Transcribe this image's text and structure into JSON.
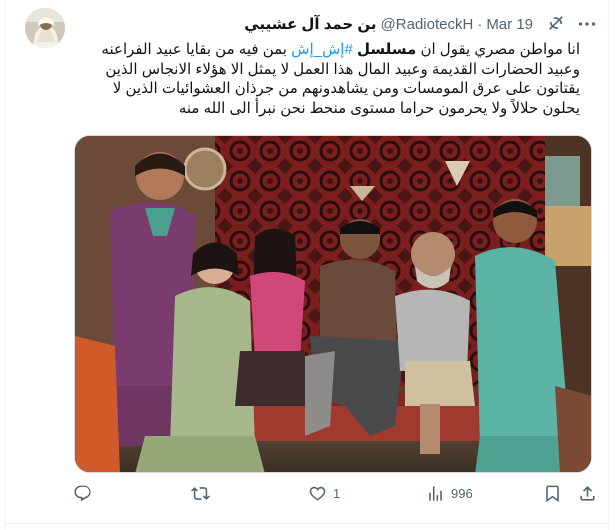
{
  "author": {
    "display_name": "بن حمد آل عشيبي",
    "handle": "@RadioteckH",
    "separator": "·",
    "date": "Mar 19"
  },
  "tweet": {
    "text_before_bold": "انا مواطن مصري يقول ان ",
    "bold_word": "مسلسل",
    "hashtag": "#إش_إش",
    "text_after": " بمن فيه من بقايا عبيد الفراعنه وعبيد الحضارات القديمة وعبيد المال هذا العمل لا يمثل الا هؤلاء الانجاس الذين يقتاتون على عرق المومسات ومن يشاهدونهم من جرذان العشوائيات الذين لا يحلون حلالاً ولا يحرمون حراما مستوى منحط نحن نبرأ الى الله منه"
  },
  "actions": {
    "reply_icon": "reply-icon",
    "retweet_icon": "retweet-icon",
    "like_icon": "heart-icon",
    "like_count": "1",
    "views_icon": "views-icon",
    "views_count": "996",
    "bookmark_icon": "bookmark-icon",
    "share_icon": "share-icon"
  },
  "colors": {
    "text": "#0f1419",
    "secondary": "#536471",
    "link": "#1d9bf0",
    "border": "#eff3f4"
  }
}
